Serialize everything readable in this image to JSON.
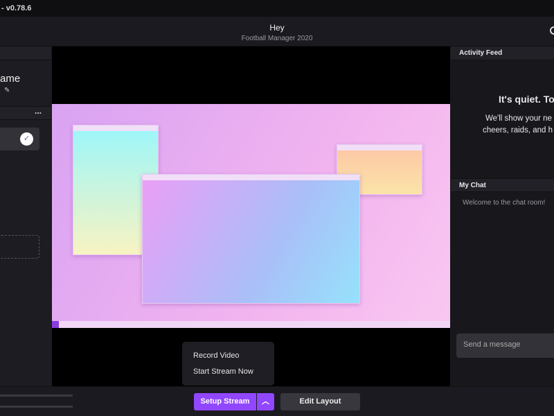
{
  "app": {
    "version": "- v0.78.6"
  },
  "header": {
    "title": "Hey",
    "subtitle": "Football Manager 2020"
  },
  "left": {
    "name": "ame",
    "more": "..."
  },
  "right": {
    "activity_title": "Activity Feed",
    "quiet_title": "It's quiet. To",
    "quiet_line1": "We'll show your ne",
    "quiet_line2": "cheers, raids, and h",
    "chat_title": "My Chat",
    "welcome": "Welcome to the chat room!",
    "send_placeholder": "Send a message"
  },
  "menu": {
    "items": [
      "Record Video",
      "Start Stream Now"
    ]
  },
  "bottom": {
    "setup": "Setup Stream",
    "edit": "Edit Layout"
  },
  "colors": {
    "accent": "#9147ff"
  }
}
